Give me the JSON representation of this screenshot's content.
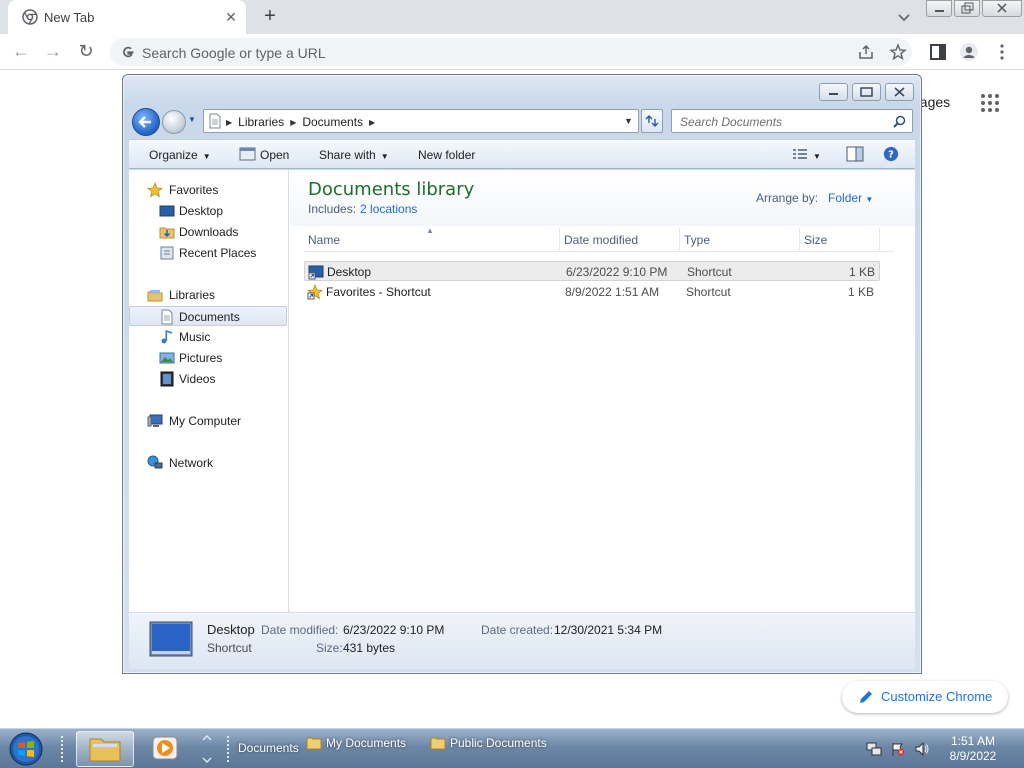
{
  "browser": {
    "tab_title": "New Tab",
    "omnibox_placeholder": "Search Google or type a URL",
    "ntp_images_partial": "nages",
    "customize_label": "Customize Chrome"
  },
  "explorer": {
    "breadcrumb": [
      "Libraries",
      "Documents"
    ],
    "search_placeholder": "Search Documents",
    "commands": {
      "organize": "Organize",
      "open": "Open",
      "share_with": "Share with",
      "new_folder": "New folder"
    },
    "nav": {
      "favorites": "Favorites",
      "desktop": "Desktop",
      "downloads": "Downloads",
      "recent_places": "Recent Places",
      "libraries": "Libraries",
      "documents": "Documents",
      "music": "Music",
      "pictures": "Pictures",
      "videos": "Videos",
      "my_computer": "My Computer",
      "network": "Network"
    },
    "library": {
      "title": "Documents library",
      "includes_label": "Includes:",
      "includes_link": "2 locations",
      "arrange_label": "Arrange by:",
      "arrange_value": "Folder"
    },
    "columns": {
      "name": "Name",
      "date_modified": "Date modified",
      "type": "Type",
      "size": "Size"
    },
    "files": [
      {
        "name": "Desktop",
        "date": "6/23/2022 9:10 PM",
        "type": "Shortcut",
        "size": "1 KB"
      },
      {
        "name": "Favorites - Shortcut",
        "date": "8/9/2022 1:51 AM",
        "type": "Shortcut",
        "size": "1 KB"
      }
    ],
    "details": {
      "name": "Desktop",
      "type": "Shortcut",
      "date_modified_label": "Date modified:",
      "date_modified": "6/23/2022 9:10 PM",
      "date_created_label": "Date created:",
      "date_created": "12/30/2021 5:34 PM",
      "size_label": "Size:",
      "size": "431 bytes"
    }
  },
  "taskbar": {
    "documents_label": "Documents",
    "my_documents": "My Documents",
    "public_documents": "Public Documents",
    "time": "1:51 AM",
    "date": "8/9/2022"
  },
  "colors": {
    "library_title": "#1e6e2a",
    "link": "#1f6ad0",
    "chrome_accent": "#1a73e8"
  }
}
